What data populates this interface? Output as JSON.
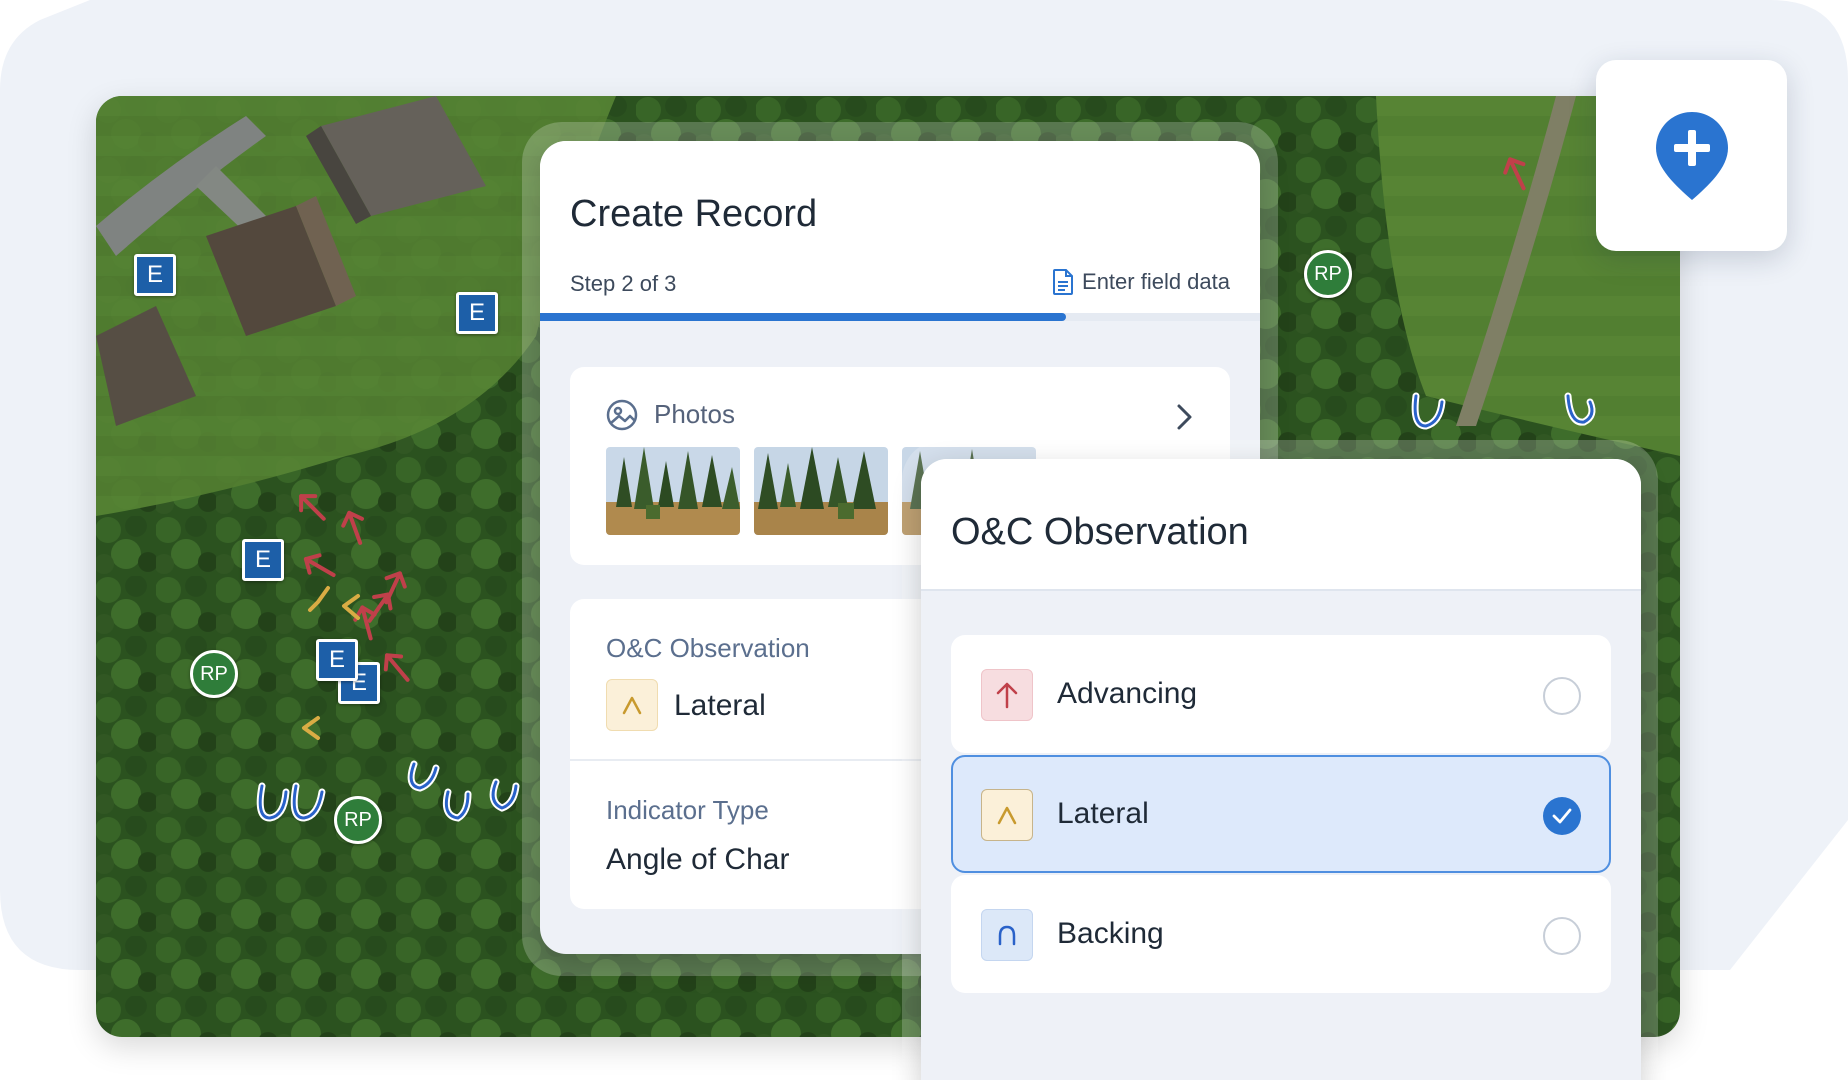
{
  "map": {
    "markers": {
      "entry_label": "E",
      "reference_point_label": "RP"
    }
  },
  "add_record_button": {
    "icon": "map-pin-plus-icon",
    "color": "#2a74d0"
  },
  "create_record": {
    "title": "Create Record",
    "step_text": "Step 2 of 3",
    "step_action": "Enter field data",
    "progress_percent": 73,
    "photos": {
      "label": "Photos",
      "thumbnail_count": 3
    },
    "fields": [
      {
        "label": "O&C Observation",
        "value": "Lateral",
        "icon": "lateral-caret-icon"
      },
      {
        "label": "Indicator Type",
        "value": "Angle of Char"
      }
    ]
  },
  "observation_picker": {
    "title": "O&C Observation",
    "options": [
      {
        "label": "Advancing",
        "icon": "advancing-arrow-icon",
        "color": "#c0404a",
        "selected": false
      },
      {
        "label": "Lateral",
        "icon": "lateral-caret-icon",
        "color": "#c89a2e",
        "selected": true
      },
      {
        "label": "Backing",
        "icon": "backing-arch-icon",
        "color": "#2a62c9",
        "selected": false
      }
    ]
  },
  "colors": {
    "accent": "#2a74d0",
    "advancing": "#c0404a",
    "lateral": "#c89a2e",
    "backing": "#2a62c9",
    "entry_marker": "#1d5fa8",
    "rp_marker": "#2f7d3a"
  }
}
